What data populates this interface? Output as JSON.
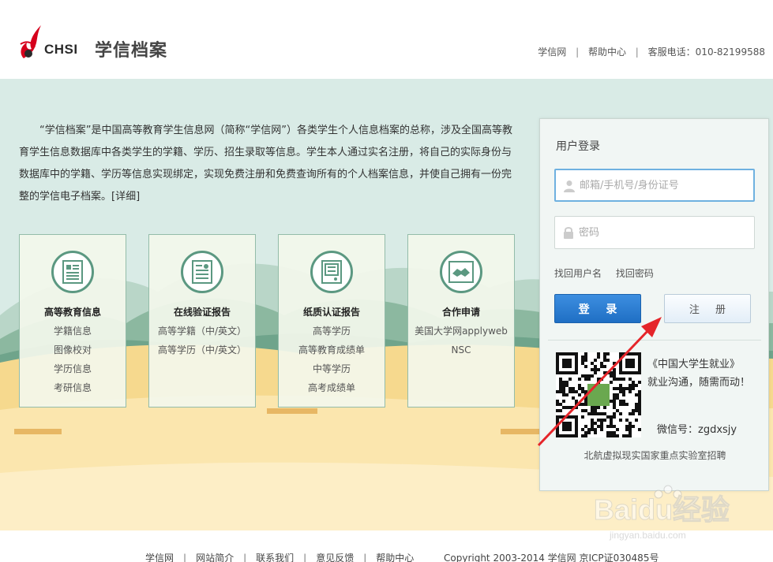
{
  "header": {
    "brand_text": "CHSI",
    "site_name": "学信档案",
    "links": [
      "学信网",
      "帮助中心"
    ],
    "hotline": "客服电话：010-82199588"
  },
  "intro": {
    "text": "“学信档案”是中国高等教育学生信息网（简称“学信网”）各类学生个人信息档案的总称，涉及全国高等教育学生信息数据库中各类学生的学籍、学历、招生录取等信息。学生本人通过实名注册，将自己的实际身份与数据库中的学籍、学历等信息实现绑定，实现免费注册和免费查询所有的个人档案信息，并使自己拥有一份完整的学信电子档案。",
    "more_link": "[详细]"
  },
  "cards": [
    {
      "title": "高等教育信息",
      "icon": "document-list-icon",
      "items": [
        "学籍信息",
        "图像校对",
        "学历信息",
        "考研信息"
      ]
    },
    {
      "title": "在线验证报告",
      "icon": "certificate-report-icon",
      "items": [
        "高等学籍（中/英文）",
        "高等学历（中/英文）"
      ]
    },
    {
      "title": "纸质认证报告",
      "icon": "paper-report-icon",
      "items": [
        "高等学历",
        "高等教育成绩单",
        "中等学历",
        "高考成绩单"
      ]
    },
    {
      "title": "合作申请",
      "icon": "handshake-icon",
      "items": [
        "美国大学网applyweb",
        "NSC"
      ]
    }
  ],
  "login": {
    "heading": "用户登录",
    "username_placeholder": "邮箱/手机号/身份证号",
    "password_placeholder": "密码",
    "find_username": "找回用户名",
    "find_password": "找回密码",
    "login_button": "登 录",
    "register_button": "注 册",
    "promo_title": "《中国大学生就业》",
    "promo_sub": "就业沟通，随需而动！",
    "wechat_id": "微信号：zgdxsjy",
    "recruit_text": "北航虚拟现实国家重点实验室招聘"
  },
  "footer": {
    "links": [
      "学信网",
      "网站简介",
      "联系我们",
      "意见反馈",
      "帮助中心"
    ],
    "copyright": "Copyright 2003-2014 学信网 京ICP证030485号"
  },
  "watermark": {
    "text": "Baidu经验",
    "url_text": "jingyan.baidu.com"
  },
  "colors": {
    "accent_blue": "#1f6fc4",
    "logo_red": "#d6001c",
    "card_border": "#93bca9",
    "arrow_red": "#e5252a"
  }
}
